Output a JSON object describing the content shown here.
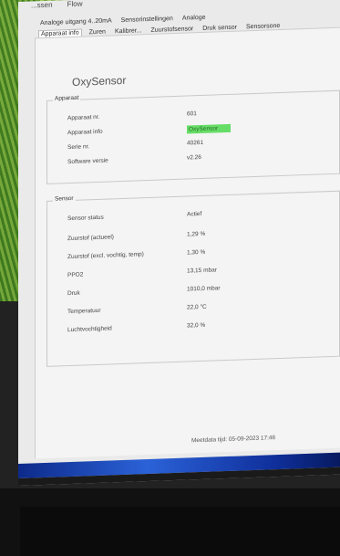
{
  "menubar": {
    "items": [
      "...ssen",
      "Flow"
    ]
  },
  "tabs": {
    "row1": [
      "Analoge uitgang 4..20mA",
      "Sensorinstellingen",
      "Analoge"
    ],
    "row2": [
      "Apparaat info",
      "Zuren",
      "Kalibrer...",
      "Zuurstofsensor",
      "Druk sensor",
      "Sensorsone"
    ],
    "active_index": 0
  },
  "device_title": "OxySensor",
  "apparaat": {
    "label": "Apparaat",
    "rows": [
      {
        "label": "Apparaat nr.",
        "value": "601"
      },
      {
        "label": "Apparaat info",
        "value": "OxySensor"
      },
      {
        "label": "Serie nr.",
        "value": "40261"
      },
      {
        "label": "Software versie",
        "value": "v2.26"
      }
    ]
  },
  "sensor": {
    "label": "Sensor",
    "rows": [
      {
        "label": "Sensor status",
        "value": "Actief"
      },
      {
        "label": "Zuurstof (actueel)",
        "value": "1,29 %"
      },
      {
        "label": "Zuurstof (excl. vochtig, temp)",
        "value": "1,30 %"
      },
      {
        "label": "PPO2",
        "value": "13,15 mbar"
      },
      {
        "label": "Druk",
        "value": "1010,0 mbar"
      },
      {
        "label": "Temperatuur",
        "value": "22,0 °C"
      },
      {
        "label": "Luchtvochtigheid",
        "value": "32,0 %"
      }
    ]
  },
  "footer_text": "Meetdata tijd: 05-09-2023 17:46",
  "colors": {
    "highlight": "#66dd66",
    "taskbar": "#2b62d8"
  }
}
